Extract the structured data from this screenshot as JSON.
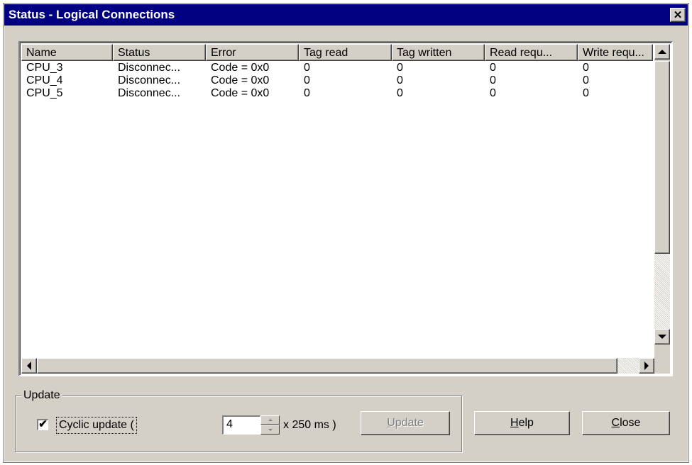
{
  "window": {
    "title": "Status - Logical Connections",
    "close_glyph": "✕"
  },
  "list": {
    "columns": [
      "Name",
      "Status",
      "Error",
      "Tag read",
      "Tag written",
      "Read requ...",
      "Write requ..."
    ],
    "rows": [
      [
        "CPU_3",
        "Disconnec...",
        "Code = 0x0",
        "0",
        "0",
        "0",
        "0"
      ],
      [
        "CPU_4",
        "Disconnec...",
        "Code = 0x0",
        "0",
        "0",
        "0",
        "0"
      ],
      [
        "CPU_5",
        "Disconnec...",
        "Code = 0x0",
        "0",
        "0",
        "0",
        "0"
      ]
    ]
  },
  "update_group": {
    "label": "Update",
    "cyclic_label": "Cyclic update (",
    "cyclic_checked": true,
    "interval_value": "4",
    "interval_suffix": "x 250 ms )",
    "update_button": {
      "mnemonic": "U",
      "rest": "pdate",
      "enabled": false
    }
  },
  "buttons": {
    "help": {
      "mnemonic": "H",
      "rest": "elp"
    },
    "close": {
      "mnemonic": "C",
      "rest": "lose"
    }
  },
  "icons": {
    "scroll_up": "triangle-up-icon",
    "scroll_down": "triangle-down-icon",
    "scroll_left": "triangle-left-icon",
    "scroll_right": "triangle-right-icon"
  },
  "colors": {
    "titlebar": "#000080",
    "dialog": "#d4d0c8",
    "list_bg": "#ffffff"
  }
}
